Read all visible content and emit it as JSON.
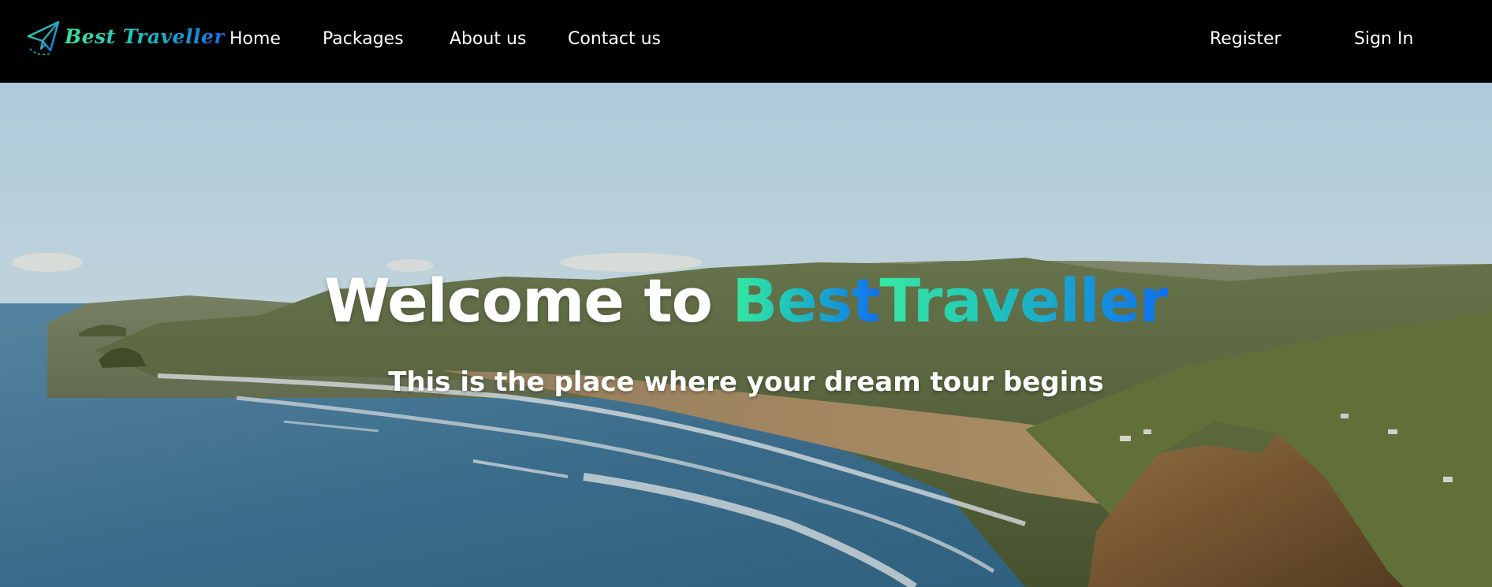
{
  "brand": {
    "logo_text": "Best Traveller",
    "logo_icon": "paper-plane-icon"
  },
  "nav": {
    "home": "Home",
    "packages": "Packages",
    "about": "About us",
    "contact": "Contact us",
    "register": "Register",
    "sign_in": "Sign In"
  },
  "hero": {
    "title_prefix": "Welcome to ",
    "title_brand_1": "Best",
    "title_brand_2": "Traveller",
    "subtitle": "This is the place where your dream tour begins",
    "background": "coastal-landscape-image"
  },
  "colors": {
    "navbar_bg": "#000000",
    "gradient_start": "#37e8a2",
    "gradient_end": "#0f6ff0",
    "text": "#ffffff"
  }
}
